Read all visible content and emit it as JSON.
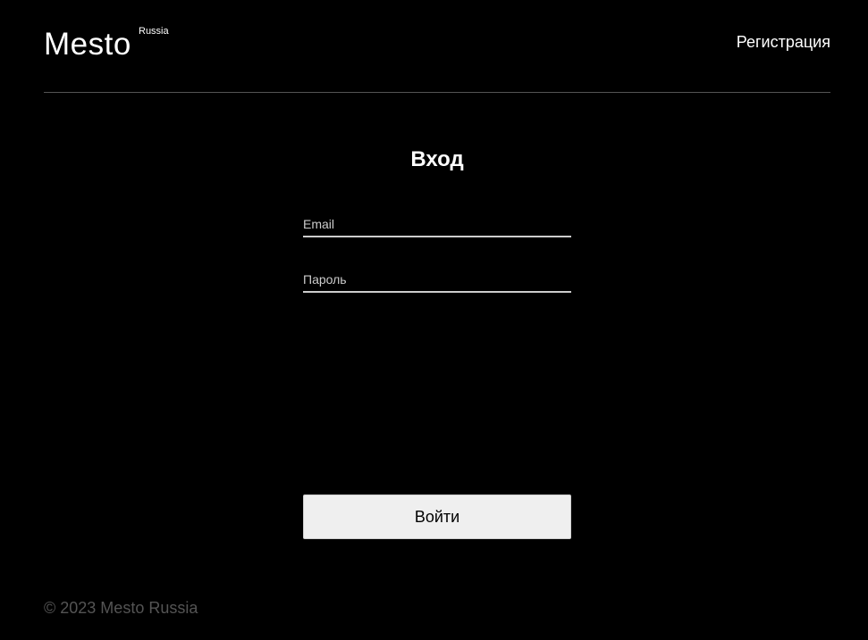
{
  "header": {
    "logo_text": "Mesto",
    "logo_superscript": "Russia",
    "nav_link_label": "Регистрация"
  },
  "login_form": {
    "title": "Вход",
    "email_field": {
      "value": "",
      "placeholder": "Email"
    },
    "password_field": {
      "value": "",
      "placeholder": "Пароль"
    },
    "submit_label": "Войти"
  },
  "footer": {
    "copyright": "© 2023 Mesto Russia"
  },
  "colors": {
    "background": "#000000",
    "text": "#ffffff",
    "divider": "#545454",
    "input_underline": "#cccccc",
    "button_background": "#efefef",
    "footer_text": "#545454"
  }
}
